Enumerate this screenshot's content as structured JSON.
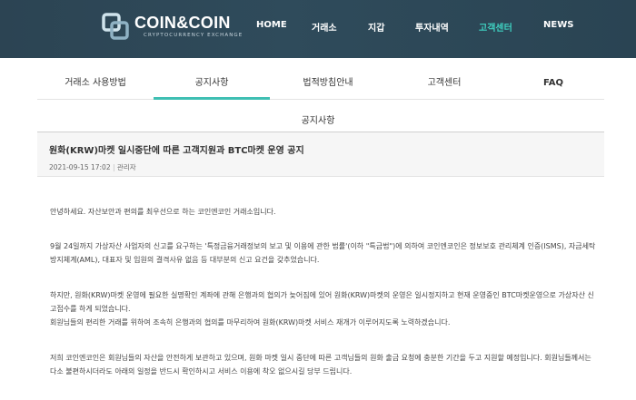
{
  "header": {
    "logo_title": "COIN&COIN",
    "logo_subtitle": "CRYPTOCURRENCY EXCHANGE",
    "nav": [
      {
        "label": "HOME"
      },
      {
        "label": "거래소"
      },
      {
        "label": "지갑"
      },
      {
        "label": "투자내역"
      },
      {
        "label": "고객센터",
        "active": true
      },
      {
        "label": "NEWS"
      }
    ],
    "accent_color": "#3fd1c1"
  },
  "tabs": [
    {
      "label": "거래소 사용방법"
    },
    {
      "label": "공지사항",
      "active": true
    },
    {
      "label": "법적방침안내"
    },
    {
      "label": "고객센터"
    },
    {
      "label": "FAQ"
    }
  ],
  "section_title": "공지사항",
  "post": {
    "title": "원화(KRW)마켓 일시중단에 따른 고객지원과 BTC마켓 운영 공지",
    "date": "2021-09-15 17:02",
    "separator": "|",
    "author": "관리자",
    "paragraphs": [
      "안녕하세요. 자산보안과 편의를 최우선으로 하는 코인엔코인 거래소입니다.",
      "9월 24일까지 가상자산 사업자의 신고를 요구하는 '특정금융거래정보의 보고 및 이용에 관한 법률'(이하 \"특금법\")에 의하여 코인엔코인은 정보보호 관리체계 인증(ISMS), 자금세탁방지체계(AML), 대표자 및 임원의 결격사유 없음 등 대부분의 신고 요건을 갖추었습니다.",
      "하지만, 원화(KRW)마켓 운영에 필요한 실명확인 계좌에 관해 은행과의 협의가 늦어짐에 있어 원화(KRW)마켓의 운영은 일시정지하고 현재 운영중인 BTC마켓운영으로 가상자산 신고접수를 하게 되었습니다.",
      "회원님들의 편리한 거래를 위하여 조속히 은행과의 협의를 마무리하여 원화(KRW)마켓 서비스 재개가 이루어지도록 노력하겠습니다.",
      "저희 코인엔코인은 회원님들의 자산을 안전하게 보관하고 있으며, 원화 마켓 일시 중단에 따른 고객님들의 원화 출금 요청에 충분한 기간을 두고 지원할 예정입니다. 회원님들께서는 다소 불편하시더라도 아래의 일정을 반드시 확인하시고 서비스 이용에 착오 없으시길 당부 드립니다."
    ]
  }
}
